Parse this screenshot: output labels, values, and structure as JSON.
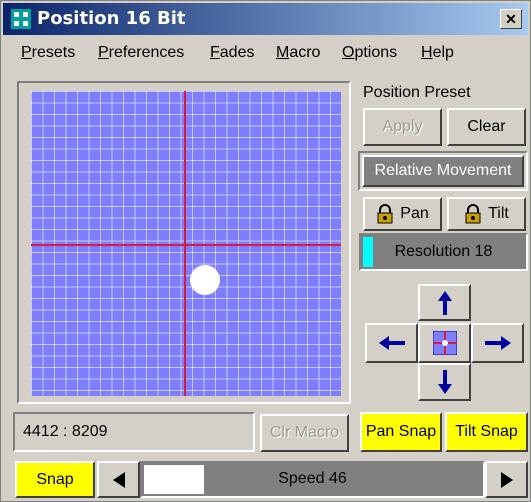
{
  "window": {
    "title": "Position 16 Bit"
  },
  "menu": {
    "items": [
      "Presets",
      "Preferences",
      "Fades",
      "Macro",
      "Options",
      "Help"
    ]
  },
  "preset": {
    "heading": "Position Preset",
    "apply_label": "Apply",
    "clear_label": "Clear"
  },
  "relative_movement_label": "Relative Movement",
  "pan_lock_label": "Pan",
  "tilt_lock_label": "Tilt",
  "resolution": {
    "label": "Resolution 18",
    "indicator_color": "#00ffff"
  },
  "coordinates": "4412 : 8209",
  "clr_macro_label": "Clr Macro",
  "pan_snap_label": "Pan Snap",
  "tilt_snap_label": "Tilt Snap",
  "snap_label": "Snap",
  "speed": {
    "label": "Speed 46",
    "value": 46
  },
  "colors": {
    "grid": "#7e7eff",
    "crosshair": "#d81b3c",
    "snap_yellow": "#ffff00",
    "arrow": "#0000a0"
  }
}
